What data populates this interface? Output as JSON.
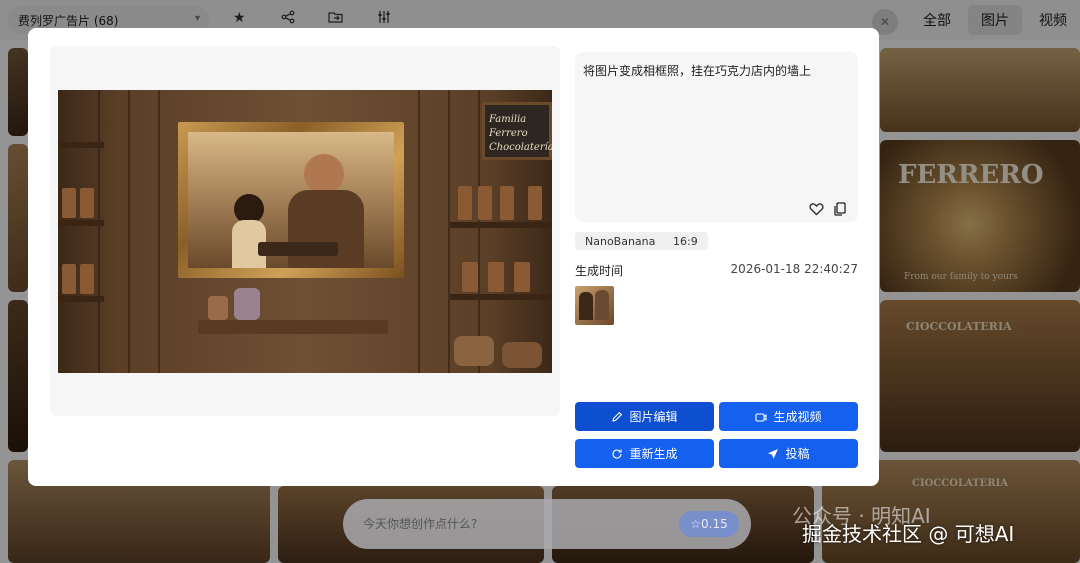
{
  "topbar": {
    "album_name": "费列罗广告片 (68)",
    "tools": [
      "star-icon",
      "share-icon",
      "folder-move-icon",
      "sliders-icon"
    ],
    "filters": [
      {
        "label": "全部",
        "active": false
      },
      {
        "label": "图片",
        "active": true
      },
      {
        "label": "视频",
        "active": false
      }
    ]
  },
  "gallery": {
    "ferrero_text": "FERRERO",
    "family_text": "From our family to yours",
    "cioccolateria_text": "CIOCCOLATERIA",
    "cioccolateria_text_2": "CIOCCOLATERIA"
  },
  "modal": {
    "image_sign_text": "Familia Ferrero Chocolatería",
    "prompt": "将图片变成相框照，挂在巧克力店内的墙上",
    "tags": [
      "NanoBanana",
      "16:9"
    ],
    "meta": {
      "label": "生成时间",
      "value": "2026-01-18 22:40:27"
    },
    "actions": {
      "edit": "图片编辑",
      "video": "生成视频",
      "regenerate": "重新生成",
      "submit": "投稿"
    }
  },
  "prompt_bar": {
    "placeholder": "今天你想创作点什么?",
    "credit": "☆0.15"
  },
  "watermark": {
    "faint": "公众号 · 明知AI",
    "main": "掘金技术社区 @ 可想AI"
  },
  "colors": {
    "primary": "#1660f0",
    "primary_active": "#0d4fd0"
  }
}
